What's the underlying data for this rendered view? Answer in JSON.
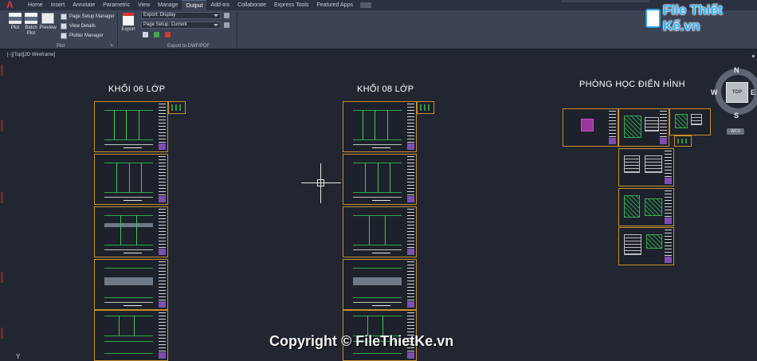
{
  "ribbon": {
    "tabs": [
      "Home",
      "Insert",
      "Annotate",
      "Parametric",
      "View",
      "Manage",
      "Output",
      "Add-ins",
      "Collaborate",
      "Express Tools",
      "Featured Apps"
    ],
    "active_tab": "Output",
    "plot_panel": {
      "title": "Plot",
      "plot_label": "Plot",
      "batch_plot_label": "Batch\nPlot",
      "preview_label": "Preview",
      "page_setup_manager": "Page Setup Manager",
      "view_details": "View Details",
      "plotter_manager": "Plotter Manager"
    },
    "export_panel": {
      "title": "Export to DWF/PDF",
      "export_label": "Export",
      "export_dropdown": "Export: Display",
      "page_setup_dropdown": "Page Setup: Current"
    }
  },
  "logo": {
    "text": "File Thiết Kế.vn"
  },
  "viewport": {
    "label": "[−][Top][2D Wireframe]",
    "block_titles": {
      "khoi06": "KHỐI 06 LỚP",
      "khoi08": "KHỐI 08 LỚP",
      "phonghoc": "PHÒNG HỌC ĐIỂN HÌNH"
    },
    "viewcube": {
      "face": "TOP",
      "north": "N",
      "south": "S",
      "east": "E",
      "west": "W",
      "wcs": "WCS"
    },
    "copyright": "Copyright © FileThietKe.vn",
    "ucs_axis": "Y"
  }
}
